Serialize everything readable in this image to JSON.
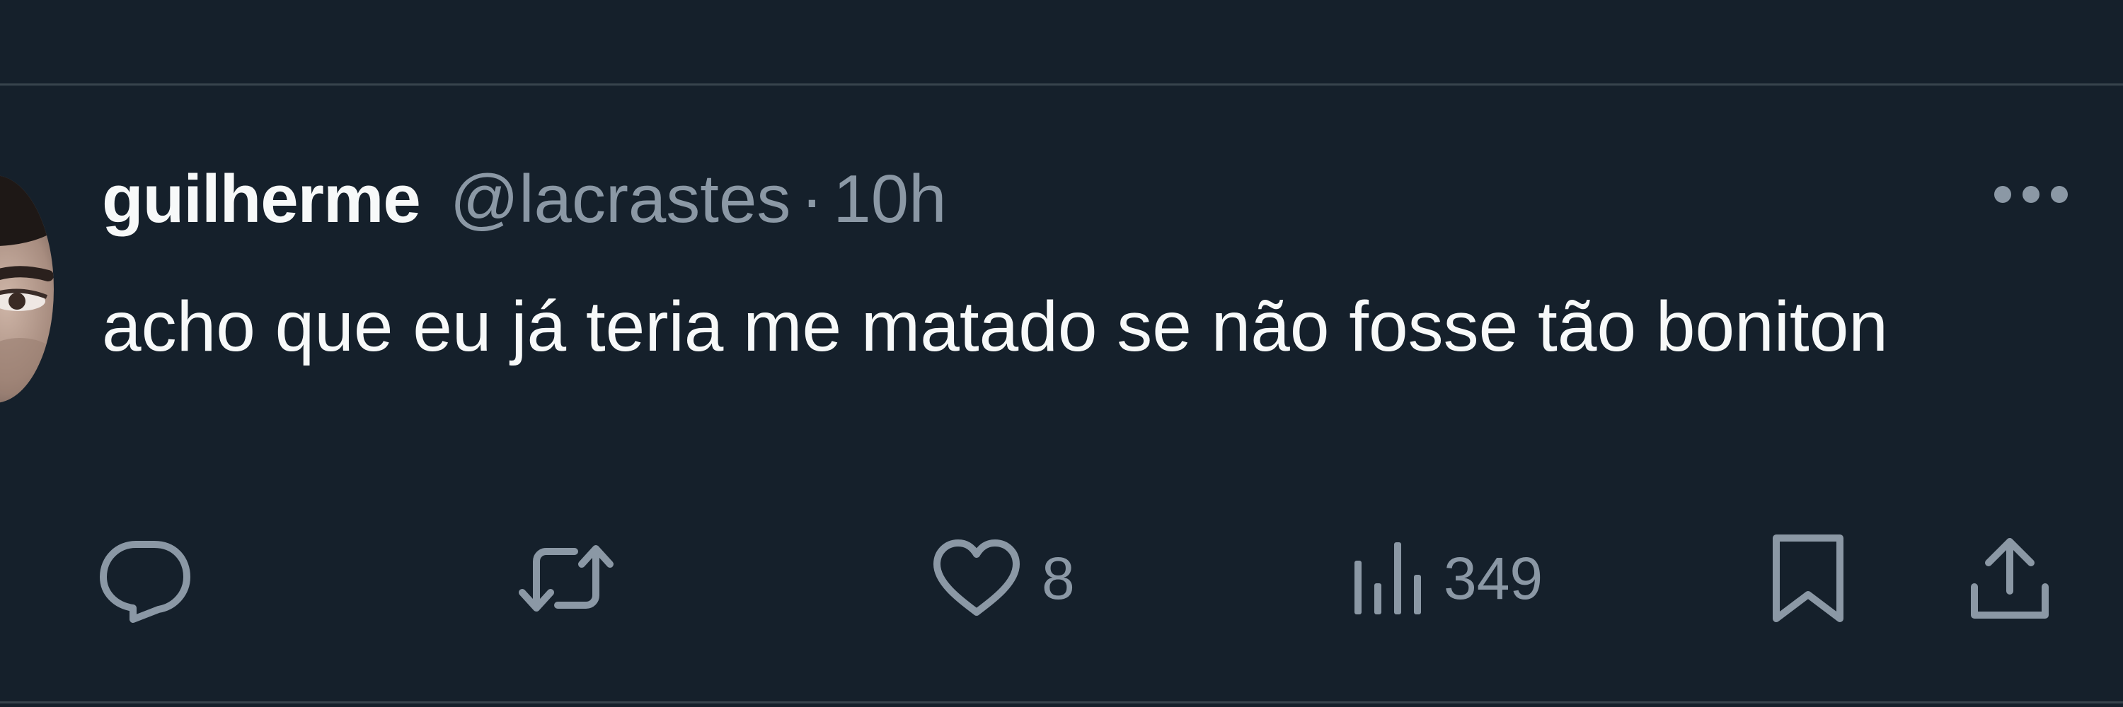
{
  "tweet": {
    "display_name": "guilherme",
    "handle": "@lacrastes",
    "separator": "·",
    "time": "10h",
    "text": "acho que eu já teria me matado se não fosse tão boniton",
    "more_icon": "more-horizontal-icon",
    "avatar_icon": "user-avatar"
  },
  "actions": {
    "reply": {
      "icon": "reply-icon",
      "count": ""
    },
    "retweet": {
      "icon": "retweet-icon",
      "count": ""
    },
    "like": {
      "icon": "heart-icon",
      "count": "8"
    },
    "views": {
      "icon": "views-icon",
      "count": "349"
    },
    "bookmark": {
      "icon": "bookmark-icon"
    },
    "share": {
      "icon": "share-icon"
    }
  },
  "colors": {
    "background": "#15202b",
    "primary_text": "#f7f9f9",
    "secondary_text": "#8b98a5",
    "divider": "#38444d"
  }
}
